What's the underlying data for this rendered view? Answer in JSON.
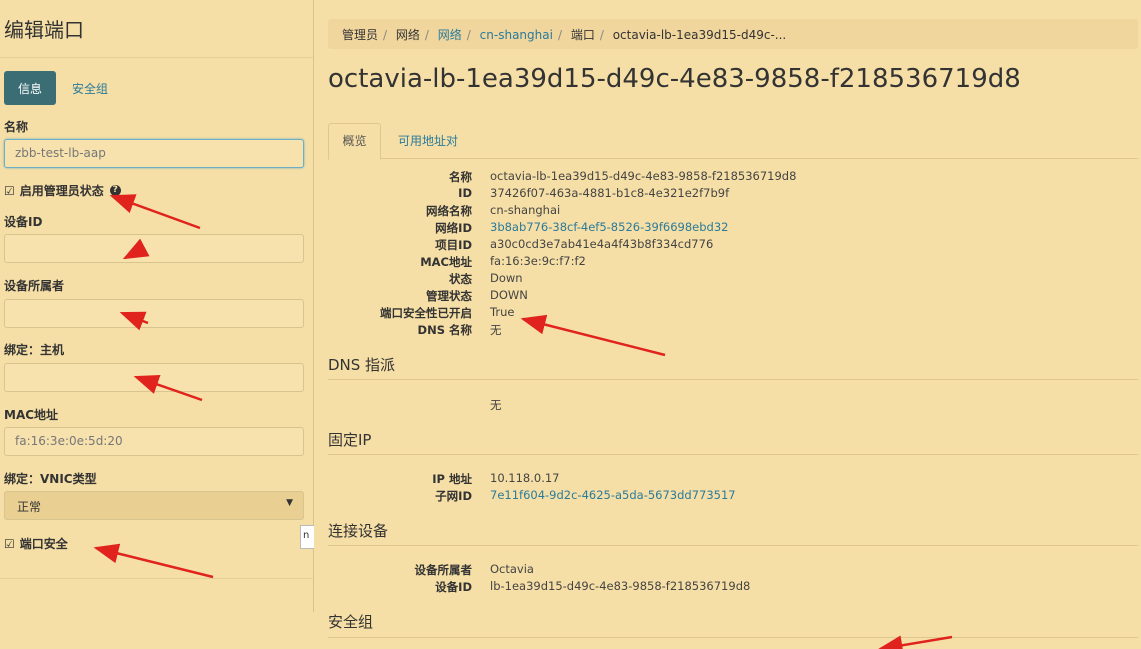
{
  "left": {
    "title": "编辑端口",
    "tabs": {
      "info": "信息",
      "security_group": "安全组"
    },
    "name_label": "名称",
    "name_value": "zbb-test-lb-aap",
    "admin_state_label": "启用管理员状态",
    "admin_state_checked": true,
    "device_id_label": "设备ID",
    "device_owner_label": "设备所属者",
    "binding_host_label": "绑定：主机",
    "mac_label": "MAC地址",
    "mac_placeholder": "fa:16:3e:0e:5d:20",
    "vnic_label": "绑定：VNIC类型",
    "vnic_value": "正常",
    "port_security_label": "端口安全",
    "port_security_checked": true,
    "tooltip_fragment": "n"
  },
  "right": {
    "breadcrumb": [
      "管理员",
      "网络",
      "网络",
      "cn-shanghai",
      "端口",
      "octavia-lb-1ea39d15-d49c-..."
    ],
    "title": "octavia-lb-1ea39d15-d49c-4e83-9858-f218536719d8",
    "tabs": [
      "概览",
      "可用地址对"
    ],
    "details": [
      {
        "k": "名称",
        "v": "octavia-lb-1ea39d15-d49c-4e83-9858-f218536719d8"
      },
      {
        "k": "ID",
        "v": "37426f07-463a-4881-b1c8-4e321e2f7b9f"
      },
      {
        "k": "网络名称",
        "v": "cn-shanghai"
      },
      {
        "k": "网络ID",
        "v": "3b8ab776-38cf-4ef5-8526-39f6698ebd32"
      },
      {
        "k": "项目ID",
        "v": "a30c0cd3e7ab41e4a4f43b8f334cd776"
      },
      {
        "k": "MAC地址",
        "v": "fa:16:3e:9c:f7:f2"
      },
      {
        "k": "状态",
        "v": "Down"
      },
      {
        "k": "管理状态",
        "v": "DOWN"
      },
      {
        "k": "端口安全性已开启",
        "v": "True"
      },
      {
        "k": "DNS 名称",
        "v": "无"
      }
    ],
    "dns_section": "DNS 指派",
    "dns_value": "无",
    "fixed_ip_section": "固定IP",
    "ip_label": "IP 地址",
    "ip_value": "10.118.0.17",
    "subnet_label": "子网ID",
    "subnet_value": "7e11f604-9d2c-4625-a5da-5673dd773517",
    "attached_section": "连接设备",
    "owner_label": "设备所属者",
    "owner_value": "Octavia",
    "device_id_label": "设备ID",
    "device_id_value": "lb-1ea39d15-d49c-4e83-9858-f218536719d8",
    "security_section": "安全组"
  },
  "colors": {
    "background": "#f6dfa6",
    "primary_tab": "#3b6d75",
    "link": "#2a7a9b",
    "annotation_arrow": "#e0231c"
  }
}
